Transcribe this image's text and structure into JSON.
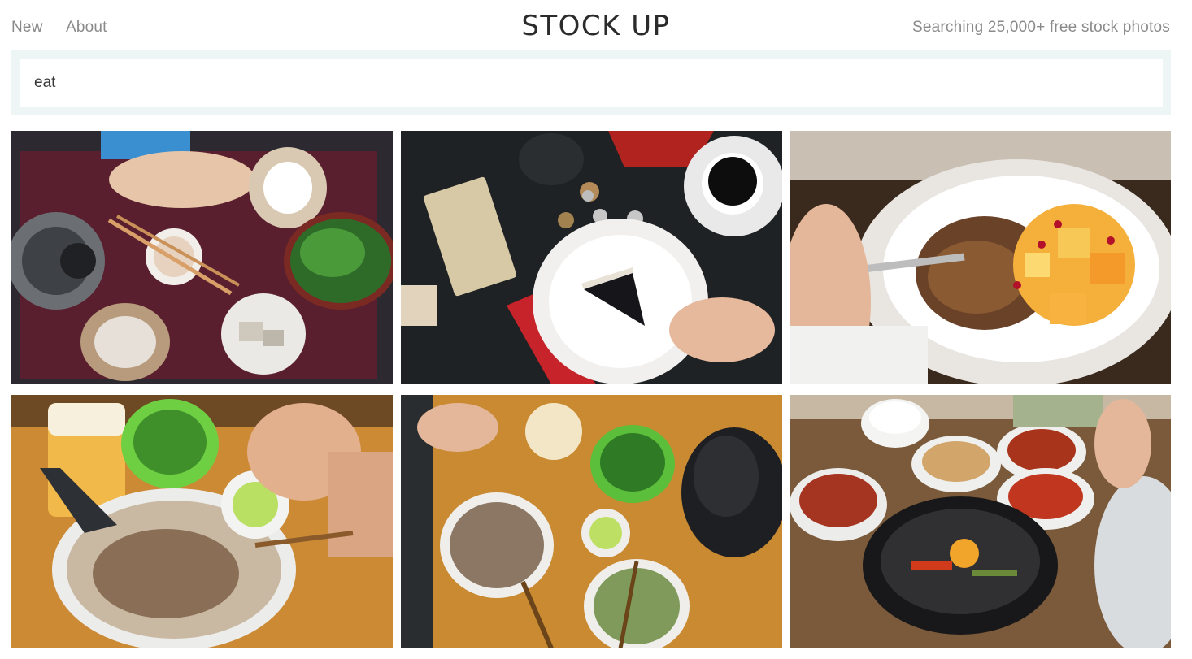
{
  "header": {
    "nav": [
      {
        "label": "New"
      },
      {
        "label": "About"
      }
    ],
    "logo": "STOCK UP",
    "tagline": "Searching 25,000+ free stock photos"
  },
  "search": {
    "value": "eat"
  },
  "photos": [
    {
      "subject": "coconut-and-herbs-table"
    },
    {
      "subject": "cake-coffee-field-notes"
    },
    {
      "subject": "granola-fruit-bowl"
    },
    {
      "subject": "pho-bowl-with-beer"
    },
    {
      "subject": "pho-noodles-table"
    },
    {
      "subject": "bibimbap-korean-sides"
    }
  ],
  "colors": {
    "search_bg": "#eef5f5",
    "text_muted": "#8a8a8a",
    "logo": "#2b2b2b"
  }
}
